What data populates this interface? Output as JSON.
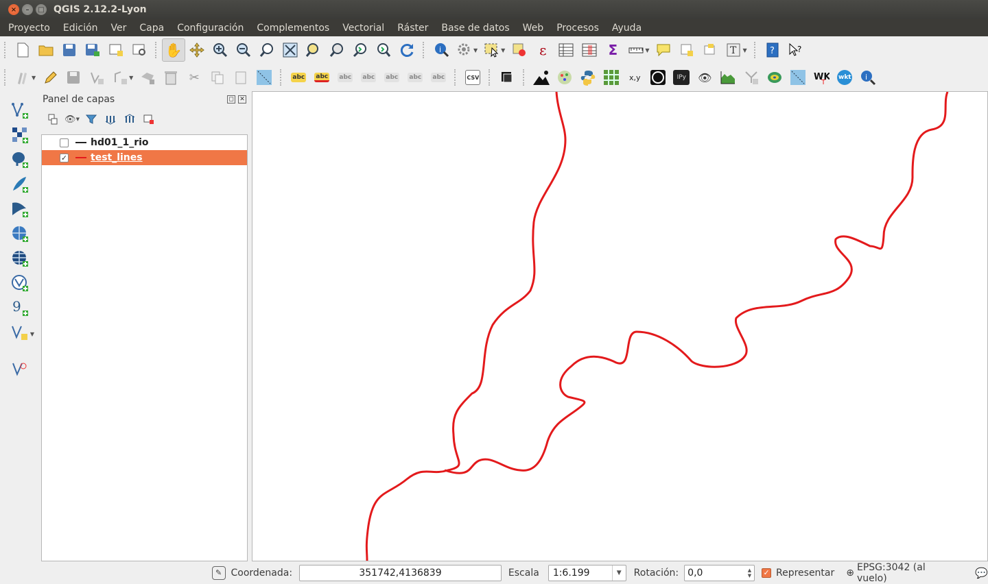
{
  "window": {
    "title": "QGIS 2.12.2-Lyon"
  },
  "menu": [
    "Proyecto",
    "Edición",
    "Ver",
    "Capa",
    "Configuración",
    "Complementos",
    "Vectorial",
    "Ráster",
    "Base de datos",
    "Web",
    "Procesos",
    "Ayuda"
  ],
  "toolbar2_labels": {
    "abc": "abc",
    "csv": "CSV",
    "xy": "x,y",
    "ipy": "IPy",
    "wkt": "wkt",
    "wk": "WK"
  },
  "layers_panel": {
    "title": "Panel de capas",
    "layers": [
      {
        "name": "hd01_1_rio",
        "checked": false,
        "selected": false,
        "symbol_color": "#222222"
      },
      {
        "name": "test_lines",
        "checked": true,
        "selected": true,
        "symbol_color": "#e31a1c"
      }
    ]
  },
  "map": {
    "line_color": "#e31a1c"
  },
  "statusbar": {
    "coord_label": "Coordenada:",
    "coord_value": "351742,4136839",
    "scale_label": "Escala",
    "scale_value": "1:6.199",
    "rotation_label": "Rotación:",
    "rotation_value": "0,0",
    "render_label": "Representar",
    "render_checked": true,
    "crs": "EPSG:3042 (al vuelo)"
  }
}
